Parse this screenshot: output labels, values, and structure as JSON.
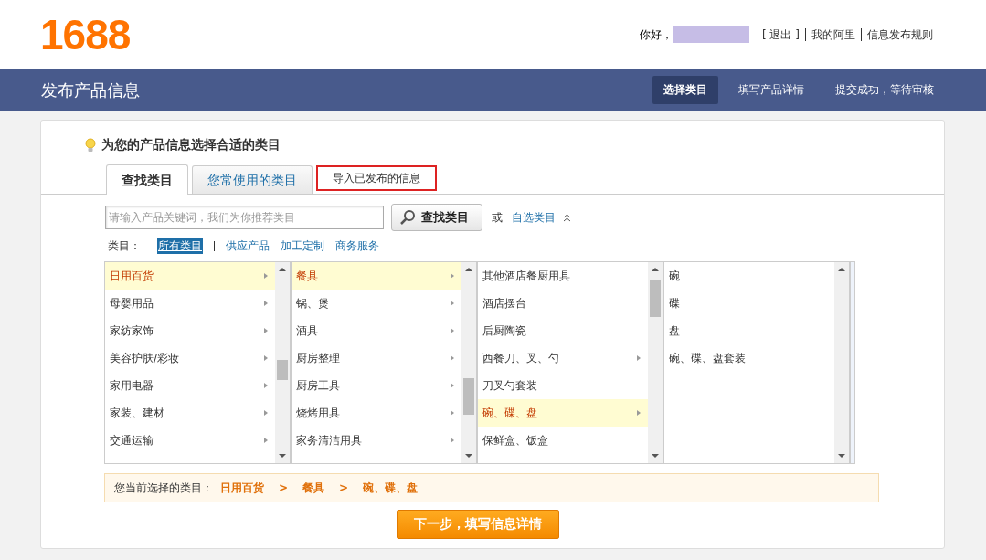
{
  "header": {
    "logo": "1688",
    "greeting": "你好，",
    "links": [
      "[ 退出 ]",
      "我的阿里",
      "信息发布规则"
    ]
  },
  "navbar": {
    "title": "发布产品信息",
    "steps": [
      {
        "label": "选择类目",
        "selected": true
      },
      {
        "label": "填写产品详情",
        "selected": false
      },
      {
        "label": "提交成功，等待审核",
        "selected": false
      }
    ]
  },
  "heading": "为您的产品信息选择合适的类目",
  "tabs": [
    {
      "label": "查找类目",
      "selected": true,
      "outlined": false
    },
    {
      "label": "您常使用的类目",
      "selected": false,
      "outlined": false
    },
    {
      "label": "导入已发布的信息",
      "selected": false,
      "outlined": true
    }
  ],
  "search": {
    "placeholder": "请输入产品关键词，我们为你推荐类目",
    "button": "查找类目",
    "or": "或",
    "custom_link": "自选类目"
  },
  "filter": {
    "label": "类目：",
    "options": [
      {
        "label": "所有类目",
        "selected": true
      },
      {
        "label": "供应产品",
        "selected": false
      },
      {
        "label": "加工定制",
        "selected": false
      },
      {
        "label": "商务服务",
        "selected": false
      }
    ]
  },
  "columns": [
    {
      "items": [
        {
          "label": "日用百货",
          "selected": true,
          "has_children": true
        },
        {
          "label": "母婴用品",
          "selected": false,
          "has_children": true
        },
        {
          "label": "家纺家饰",
          "selected": false,
          "has_children": true
        },
        {
          "label": "美容护肤/彩妆",
          "selected": false,
          "has_children": true
        },
        {
          "label": "家用电器",
          "selected": false,
          "has_children": true
        },
        {
          "label": "家装、建材",
          "selected": false,
          "has_children": true
        },
        {
          "label": "交通运输",
          "selected": false,
          "has_children": true
        }
      ]
    },
    {
      "items": [
        {
          "label": "餐具",
          "selected": true,
          "has_children": true
        },
        {
          "label": "锅、煲",
          "selected": false,
          "has_children": true
        },
        {
          "label": "酒具",
          "selected": false,
          "has_children": true
        },
        {
          "label": "厨房整理",
          "selected": false,
          "has_children": true
        },
        {
          "label": "厨房工具",
          "selected": false,
          "has_children": true
        },
        {
          "label": "烧烤用具",
          "selected": false,
          "has_children": true
        },
        {
          "label": "家务清洁用具",
          "selected": false,
          "has_children": true
        }
      ]
    },
    {
      "items": [
        {
          "label": "其他酒店餐厨用具",
          "selected": false,
          "has_children": false
        },
        {
          "label": "酒店摆台",
          "selected": false,
          "has_children": false
        },
        {
          "label": "后厨陶瓷",
          "selected": false,
          "has_children": false
        },
        {
          "label": "西餐刀、叉、勺",
          "selected": false,
          "has_children": true
        },
        {
          "label": "刀叉勺套装",
          "selected": false,
          "has_children": false
        },
        {
          "label": "碗、碟、盘",
          "selected": true,
          "has_children": true
        },
        {
          "label": "保鲜盒、饭盒",
          "selected": false,
          "has_children": false
        }
      ]
    },
    {
      "items": [
        {
          "label": "碗",
          "selected": false,
          "has_children": false
        },
        {
          "label": "碟",
          "selected": false,
          "has_children": false
        },
        {
          "label": "盘",
          "selected": false,
          "has_children": false
        },
        {
          "label": "碗、碟、盘套装",
          "selected": false,
          "has_children": false
        }
      ]
    }
  ],
  "current": {
    "label": "您当前选择的类目：",
    "path": [
      "日用百货",
      "餐具",
      "碗、碟、盘"
    ],
    "separator": ">"
  },
  "next_button": "下一步，填写信息详情"
}
